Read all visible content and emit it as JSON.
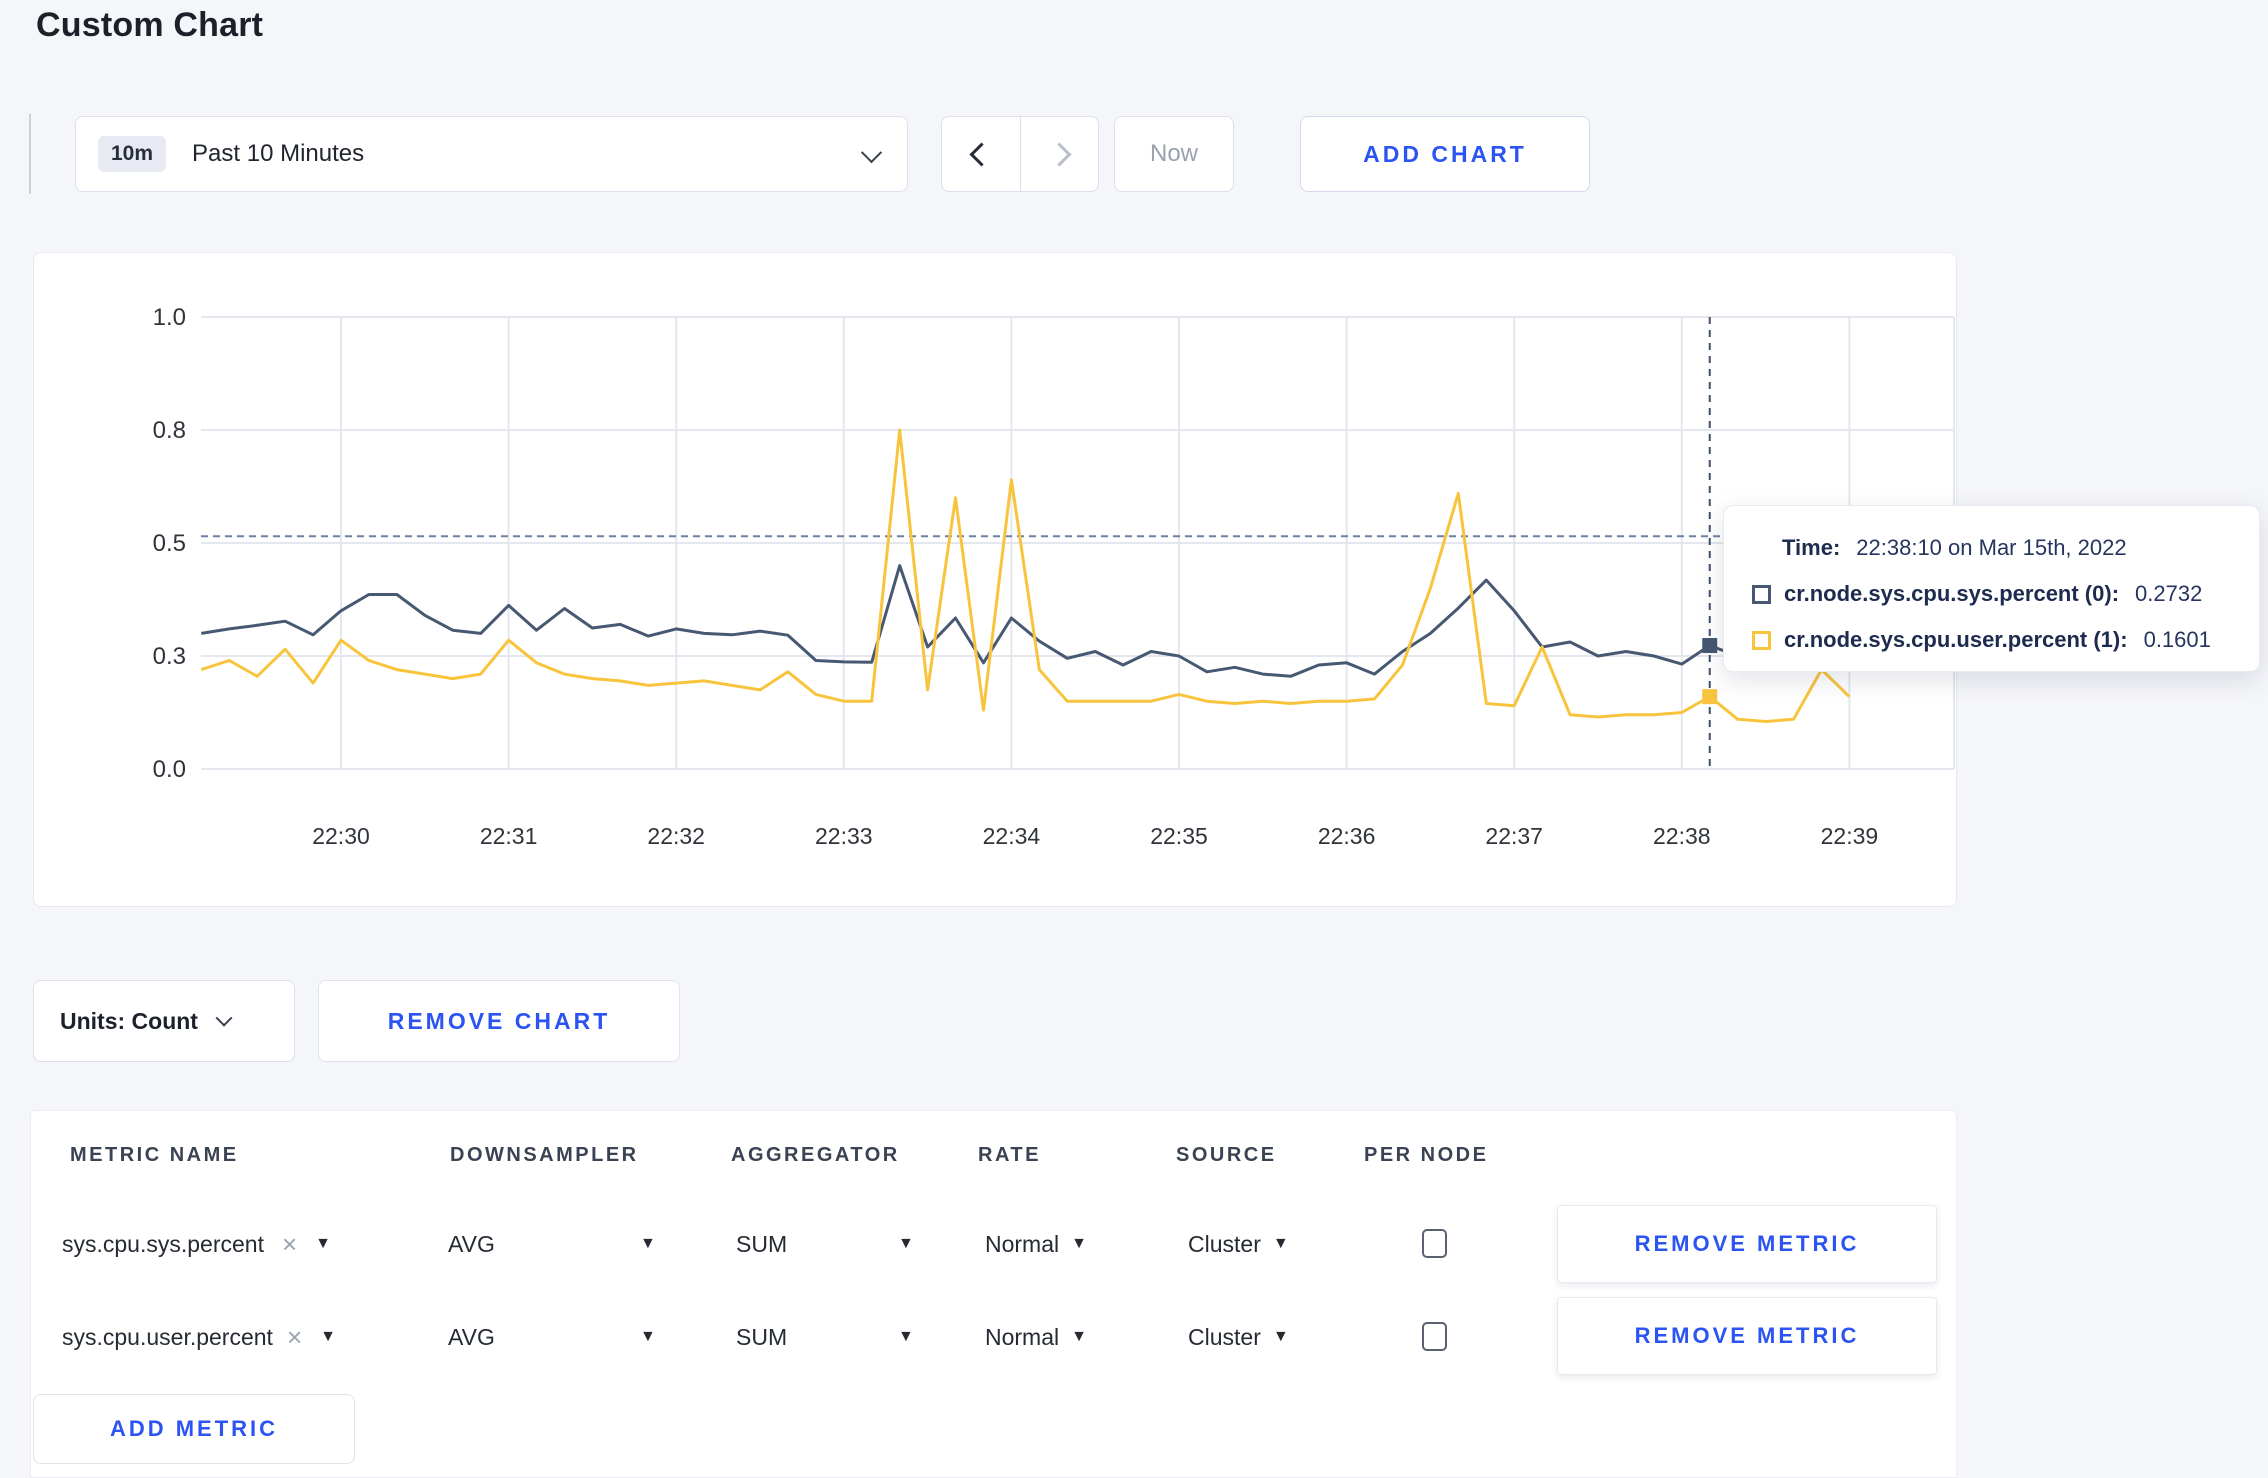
{
  "page": {
    "title": "Custom Chart"
  },
  "toolbar": {
    "range_badge": "10m",
    "range_label": "Past 10 Minutes",
    "now_label": "Now",
    "add_chart_label": "ADD CHART"
  },
  "chart": {
    "tooltip": {
      "time_label": "Time:",
      "time_value": "22:38:10 on Mar 15th, 2022",
      "series": [
        {
          "label": "cr.node.sys.cpu.sys.percent (0):",
          "value": "0.2732"
        },
        {
          "label": "cr.node.sys.cpu.user.percent (1):",
          "value": "0.1601"
        }
      ]
    }
  },
  "chart_data": {
    "type": "line",
    "title": "",
    "xlabel": "",
    "ylabel": "",
    "ylim": [
      0,
      1
    ],
    "grid": true,
    "x_ticks": [
      "22:30",
      "22:31",
      "22:32",
      "22:33",
      "22:34",
      "22:35",
      "22:36",
      "22:37",
      "22:38",
      "22:39"
    ],
    "y_ticks": [
      {
        "label": "1.0",
        "value": 1.0
      },
      {
        "label": "0.8",
        "value": 0.75
      },
      {
        "label": "0.5",
        "value": 0.5
      },
      {
        "label": "0.3",
        "value": 0.25
      },
      {
        "label": "0.0",
        "value": 0.0
      }
    ],
    "first_sample_time": "22:29:10",
    "interval_sec": 10,
    "crosshair_sec": 540,
    "crosshair_time": "22:38:10",
    "hline_value": 0.515,
    "series": [
      {
        "name": "cr.node.sys.cpu.sys.percent",
        "color": "#475872",
        "values": [
          0.3,
          0.31,
          0.318,
          0.327,
          0.297,
          0.35,
          0.386,
          0.386,
          0.34,
          0.307,
          0.3,
          0.362,
          0.307,
          0.355,
          0.312,
          0.32,
          0.294,
          0.31,
          0.3,
          0.297,
          0.305,
          0.296,
          0.24,
          0.237,
          0.236,
          0.45,
          0.27,
          0.334,
          0.235,
          0.334,
          0.283,
          0.245,
          0.26,
          0.23,
          0.26,
          0.25,
          0.215,
          0.225,
          0.21,
          0.205,
          0.23,
          0.235,
          0.21,
          0.26,
          0.3,
          0.356,
          0.418,
          0.35,
          0.27,
          0.281,
          0.25,
          0.26,
          0.25,
          0.232,
          0.2732,
          0.25,
          0.26,
          0.27,
          0.285,
          0.3
        ]
      },
      {
        "name": "cr.node.sys.cpu.user.percent",
        "color": "#f9c43d",
        "values": [
          0.22,
          0.24,
          0.205,
          0.265,
          0.19,
          0.285,
          0.24,
          0.22,
          0.21,
          0.2,
          0.21,
          0.285,
          0.235,
          0.21,
          0.2,
          0.195,
          0.185,
          0.19,
          0.195,
          0.185,
          0.175,
          0.215,
          0.165,
          0.15,
          0.15,
          0.75,
          0.175,
          0.6,
          0.13,
          0.64,
          0.22,
          0.15,
          0.15,
          0.15,
          0.15,
          0.165,
          0.15,
          0.145,
          0.15,
          0.145,
          0.15,
          0.15,
          0.155,
          0.23,
          0.4,
          0.61,
          0.145,
          0.14,
          0.27,
          0.12,
          0.115,
          0.12,
          0.12,
          0.125,
          0.1601,
          0.11,
          0.105,
          0.11,
          0.22,
          0.16
        ]
      }
    ]
  },
  "units_row": {
    "units_label": "Units: Count",
    "remove_chart_label": "REMOVE CHART"
  },
  "metrics_table": {
    "headers": [
      "METRIC NAME",
      "DOWNSAMPLER",
      "AGGREGATOR",
      "RATE",
      "SOURCE",
      "PER NODE"
    ],
    "rows": [
      {
        "metric": "sys.cpu.sys.percent",
        "downsampler": "AVG",
        "aggregator": "SUM",
        "rate": "Normal",
        "source": "Cluster",
        "per_node_checked": false,
        "remove_label": "REMOVE METRIC"
      },
      {
        "metric": "sys.cpu.user.percent",
        "downsampler": "AVG",
        "aggregator": "SUM",
        "rate": "Normal",
        "source": "Cluster",
        "per_node_checked": false,
        "remove_label": "REMOVE METRIC"
      }
    ],
    "add_metric_label": "ADD METRIC"
  }
}
